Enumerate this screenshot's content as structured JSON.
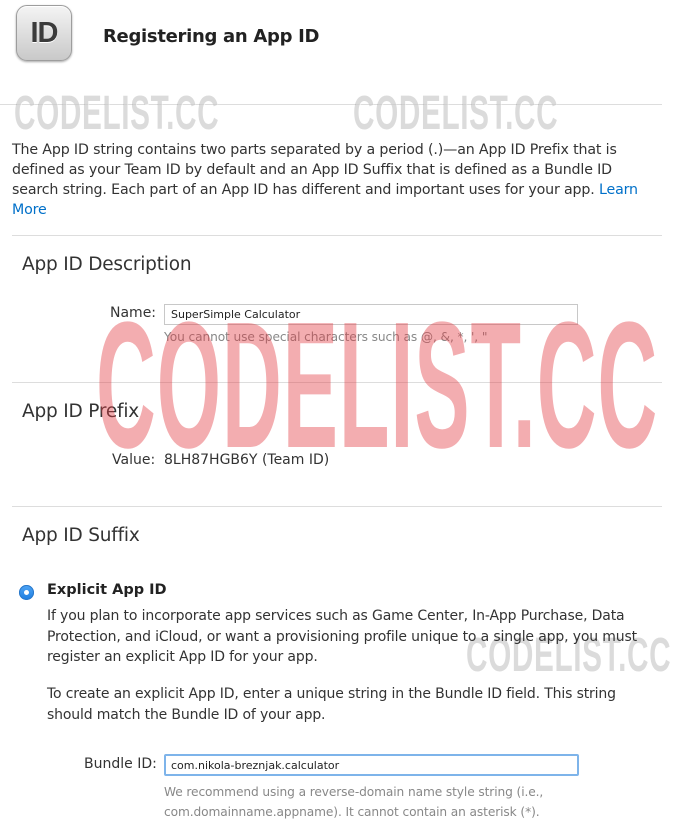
{
  "header": {
    "icon_text": "ID",
    "title": "Registering an App ID"
  },
  "intro": {
    "text": "The App ID string contains two parts separated by a period (.)—an App ID Prefix that is defined as your Team ID by default and an App ID Suffix that is defined as a Bundle ID search string. Each part of an App ID has different and important uses for your app.",
    "link": "Learn More"
  },
  "description": {
    "title": "App ID Description",
    "name_label": "Name:",
    "name_value": "SuperSimple Calculator",
    "name_hint": "You cannot use special characters such as @, &, *, ', \""
  },
  "prefix": {
    "title": "App ID Prefix",
    "value_label": "Value:",
    "value": "8LH87HGB6Y (Team ID)"
  },
  "suffix": {
    "title": "App ID Suffix",
    "explicit_label": "Explicit App ID",
    "explicit_paragraph_1": "If you plan to incorporate app services such as Game Center, In-App Purchase, Data Protection, and iCloud, or want a provisioning profile unique to a single app, you must register an explicit App ID for your app.",
    "explicit_paragraph_2": "To create an explicit App ID, enter a unique string in the Bundle ID field. This string should match the Bundle ID of your app.",
    "bundle_label": "Bundle ID:",
    "bundle_value": "com.nikola-breznjak.calculator",
    "bundle_hint": "We recommend using a reverse-domain name style string (i.e., com.domainname.appname). It cannot contain an asterisk (*)."
  },
  "watermark": {
    "text": "CODELIST.CC"
  },
  "colors": {
    "link": "#0070c9",
    "radio": "#1d7de0",
    "focus_ring": "#7eb4ea",
    "watermark_red": "#e23c42"
  }
}
